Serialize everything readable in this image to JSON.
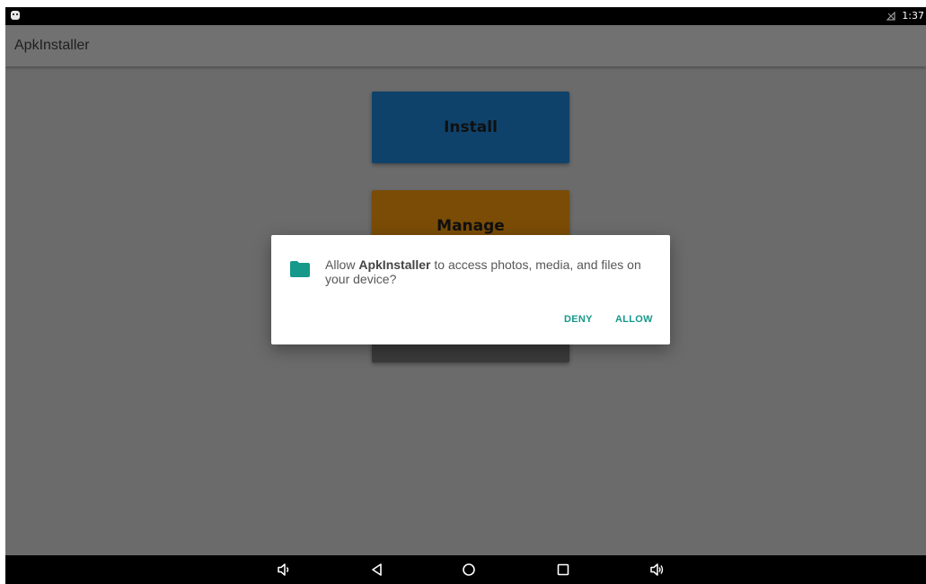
{
  "status_bar": {
    "time": "1:37"
  },
  "app_bar": {
    "title": "ApkInstaller"
  },
  "buttons": {
    "install": "Install",
    "manage": "Manage"
  },
  "dialog": {
    "message_prefix": "Allow ",
    "app_name": "ApkInstaller",
    "message_suffix": " to access photos, media, and files on your device?",
    "deny": "DENY",
    "allow": "ALLOW",
    "icon": "folder-icon",
    "accent_color": "#16998a"
  },
  "nav_bar": {
    "icons": [
      "volume-down-icon",
      "back-icon",
      "home-icon",
      "recents-icon",
      "volume-up-icon"
    ]
  }
}
